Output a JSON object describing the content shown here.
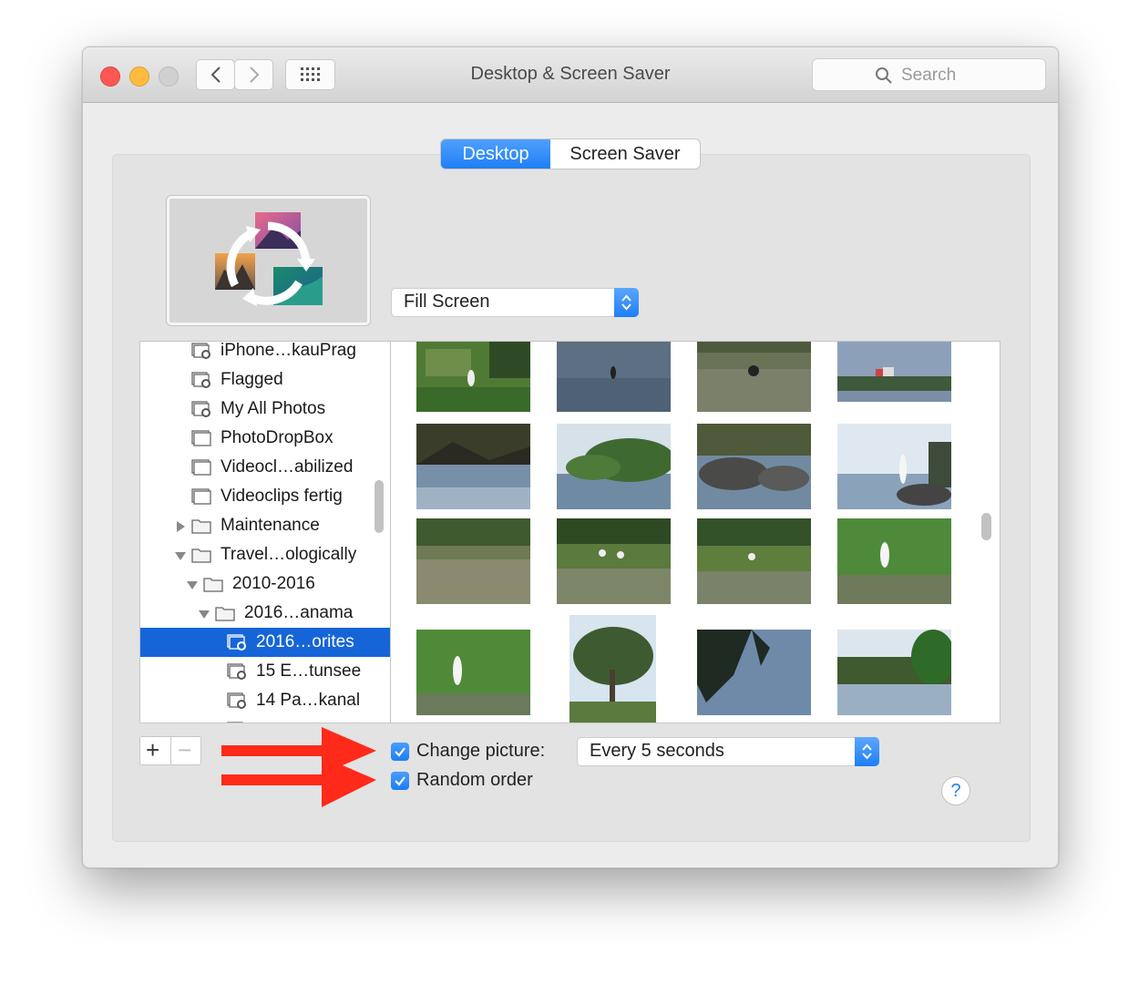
{
  "window": {
    "title": "Desktop & Screen Saver",
    "search_placeholder": "Search"
  },
  "tabs": [
    {
      "label": "Desktop",
      "active": true
    },
    {
      "label": "Screen Saver",
      "active": false
    }
  ],
  "fit_select": {
    "value": "Fill Screen"
  },
  "sidebar": {
    "items": [
      {
        "label": "iPhone…kauPrag",
        "icon": "smart-album-icon",
        "disclosure": ""
      },
      {
        "label": "Flagged",
        "icon": "smart-album-icon",
        "disclosure": ""
      },
      {
        "label": "My All Photos",
        "icon": "smart-album-icon",
        "disclosure": ""
      },
      {
        "label": "PhotoDropBox",
        "icon": "album-icon",
        "disclosure": ""
      },
      {
        "label": "Videocl…abilized",
        "icon": "album-icon",
        "disclosure": ""
      },
      {
        "label": "Videoclips fertig",
        "icon": "album-icon",
        "disclosure": ""
      },
      {
        "label": "Maintenance",
        "icon": "folder-icon",
        "disclosure": "collapsed"
      },
      {
        "label": "Travel…ologically",
        "icon": "folder-icon",
        "disclosure": "expanded"
      },
      {
        "label": "2010-2016",
        "icon": "folder-icon",
        "disclosure": "expanded"
      },
      {
        "label": "2016…anama",
        "icon": "folder-icon",
        "disclosure": "expanded"
      },
      {
        "label": "2016…orites",
        "icon": "smart-album-icon",
        "disclosure": "",
        "selected": true
      },
      {
        "label": "15 E…tunsee",
        "icon": "smart-album-icon",
        "disclosure": ""
      },
      {
        "label": "14 Pa…kanal",
        "icon": "smart-album-icon",
        "disclosure": ""
      }
    ]
  },
  "photos": [
    {
      "desc": "egret-on-riverbank"
    },
    {
      "desc": "bird-on-water"
    },
    {
      "desc": "bird-wading"
    },
    {
      "desc": "distant-shore"
    },
    {
      "desc": "dark-shore-trees"
    },
    {
      "desc": "island-with-trees"
    },
    {
      "desc": "rocks-in-water"
    },
    {
      "desc": "egret-on-rock"
    },
    {
      "desc": "marsh-water"
    },
    {
      "desc": "birds-in-reeds"
    },
    {
      "desc": "birds-in-marsh"
    },
    {
      "desc": "egret-in-marsh"
    },
    {
      "desc": "egret-in-grass"
    },
    {
      "desc": "large-tree"
    },
    {
      "desc": "tree-silhouette"
    },
    {
      "desc": "river-jungle"
    }
  ],
  "options": {
    "change_picture_label": "Change picture:",
    "change_picture_checked": true,
    "interval_value": "Every 5 seconds",
    "random_order_label": "Random order",
    "random_order_checked": true
  },
  "buttons": {
    "add": "+",
    "remove": "−",
    "help": "?"
  },
  "colors": {
    "accent": "#1f7ff5",
    "selection": "#1665d8",
    "arrow": "#ff2a1a"
  }
}
